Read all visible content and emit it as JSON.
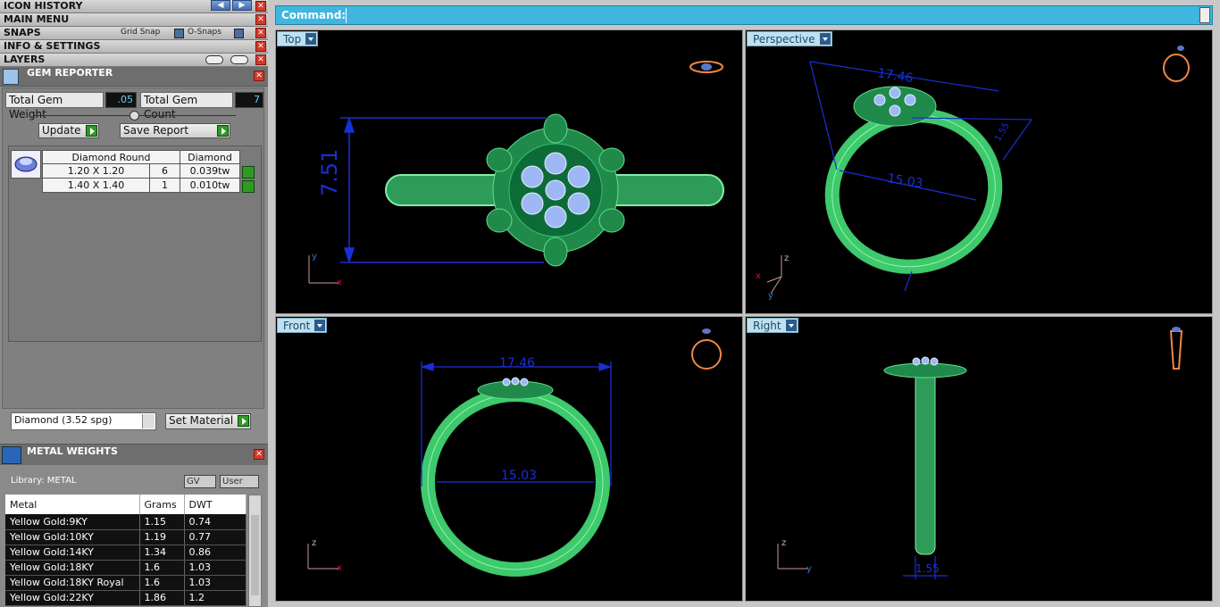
{
  "left_panel": {
    "icon_history": "ICON HISTORY",
    "main_menu": "MAIN MENU",
    "snaps": {
      "title": "SNAPS",
      "grid_snap": "Grid Snap",
      "o_snaps": "O-Snaps"
    },
    "info_settings": "INFO & SETTINGS",
    "layers": "LAYERS",
    "close_glyph": "✕",
    "back_glyph": "◀",
    "forward_glyph": "▶",
    "gem_reporter": {
      "title": "GEM REPORTER",
      "total_gem_weight_label": "Total Gem Weight",
      "total_gem_weight_value": ".05",
      "total_gem_count_label": "Total Gem Count",
      "total_gem_count_value": "7",
      "update_label": "Update",
      "save_report_label": "Save Report",
      "table_headers": [
        "Diamond Round",
        "Diamond"
      ],
      "rows": [
        {
          "size": "1.20 X 1.20",
          "count": "6",
          "weight": "0.039tw"
        },
        {
          "size": "1.40 X 1.40",
          "count": "1",
          "weight": "0.010tw"
        }
      ],
      "material_select": "Diamond    (3.52 spg)",
      "set_material_label": "Set Material"
    },
    "metal_weights": {
      "title": "METAL WEIGHTS",
      "library_label": "Library: METAL",
      "gv_label": "GV",
      "user_label": "User",
      "headers": [
        "Metal",
        "Grams",
        "DWT"
      ],
      "rows": [
        [
          "Yellow Gold:9KY",
          "1.15",
          "0.74"
        ],
        [
          "Yellow Gold:10KY",
          "1.19",
          "0.77"
        ],
        [
          "Yellow Gold:14KY",
          "1.34",
          "0.86"
        ],
        [
          "Yellow Gold:18KY",
          "1.6",
          "1.03"
        ],
        [
          "Yellow Gold:18KY Royal",
          "1.6",
          "1.03"
        ],
        [
          "Yellow Gold:22KY",
          "1.86",
          "1.2"
        ]
      ]
    }
  },
  "command": {
    "label": "Command:",
    "value": ""
  },
  "viewports": {
    "top": {
      "name": "Top",
      "dim_height": "7.51",
      "axis_v": "y",
      "axis_h": "x"
    },
    "perspective": {
      "name": "Perspective",
      "dim_a": "17.46",
      "dim_b": "15.03",
      "dim_c": "1.55",
      "axis_z": "z",
      "axis_y": "y",
      "axis_x": "x"
    },
    "front": {
      "name": "Front",
      "dim_outer": "17.46",
      "dim_inner": "15.03",
      "axis_v": "z",
      "axis_h": "x"
    },
    "right": {
      "name": "Right",
      "dim_width": "1.55",
      "axis_v": "z",
      "axis_h": "y"
    }
  },
  "colors": {
    "ring_green": "#3ec96c",
    "dim_blue": "#1a2fd6",
    "command_bar": "#3fb6e0"
  }
}
